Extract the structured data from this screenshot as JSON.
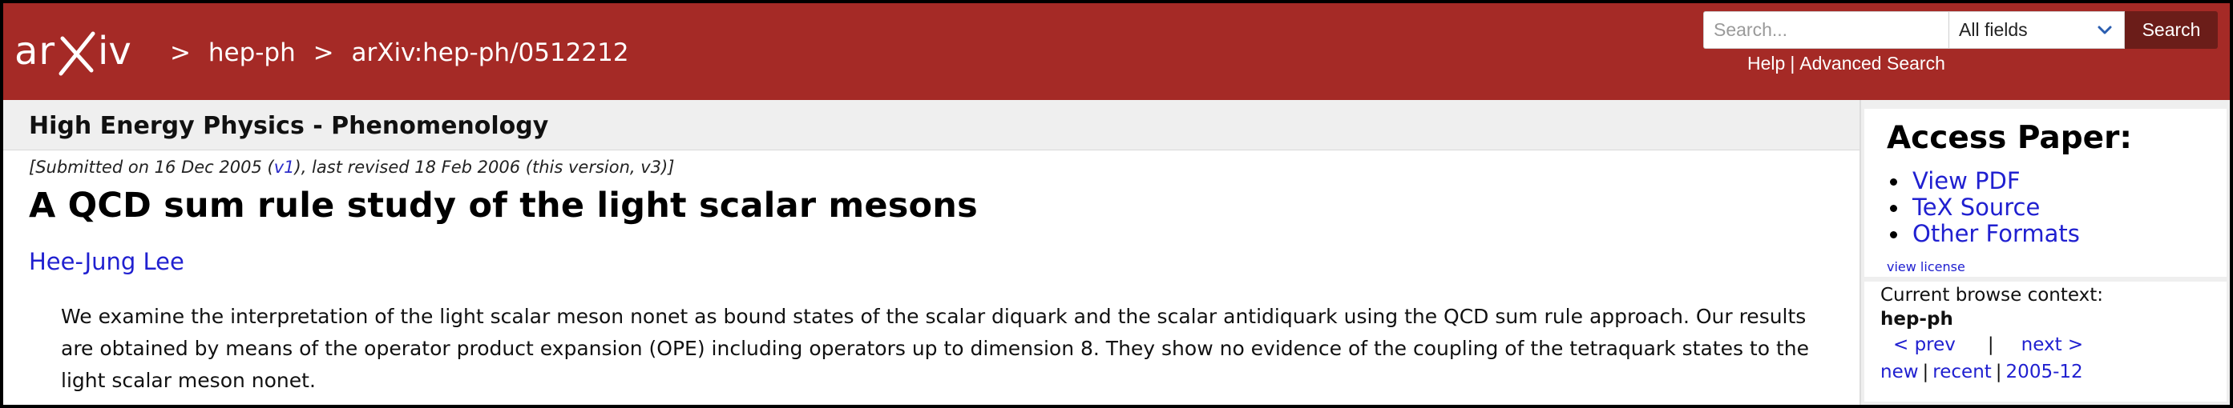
{
  "header": {
    "logo_text": "arXiv",
    "breadcrumb": [
      ">",
      "hep-ph",
      ">",
      "arXiv:hep-ph/0512212"
    ],
    "search": {
      "placeholder": "Search...",
      "value": ""
    },
    "field_select": "All fields",
    "search_button": "Search",
    "help": "Help",
    "help_sep": "|",
    "advanced_search": "Advanced Search"
  },
  "subject": "High Energy Physics - Phenomenology",
  "paper": {
    "dateline_pre": "[Submitted on 16 Dec 2005 (",
    "dateline_link": "v1",
    "dateline_post": "), last revised 18 Feb 2006 (this version, v3)]",
    "title": "A QCD sum rule study of the light scalar mesons",
    "author": "Hee-Jung Lee",
    "abstract": "We examine the interpretation of the light scalar meson nonet as bound states of the scalar diquark and the scalar antidiquark using the QCD sum rule approach. Our results are obtained by means of the operator product expansion (OPE) including operators up to dimension 8. They show no evidence of the coupling of the tetraquark states to the light scalar meson nonet."
  },
  "access": {
    "heading": "Access Paper:",
    "items": [
      "View PDF",
      "TeX Source",
      "Other Formats"
    ],
    "license": "view license"
  },
  "browse": {
    "label": "Current browse context:",
    "context": "hep-ph",
    "prev": "< prev",
    "bar": "|",
    "next": "next >",
    "new": "new",
    "recent": "recent",
    "date": "2005-12",
    "pipe": "|"
  },
  "colors": {
    "header_bg": "#a52a26",
    "search_button_bg": "#6b1d19",
    "link": "#2020d0"
  }
}
